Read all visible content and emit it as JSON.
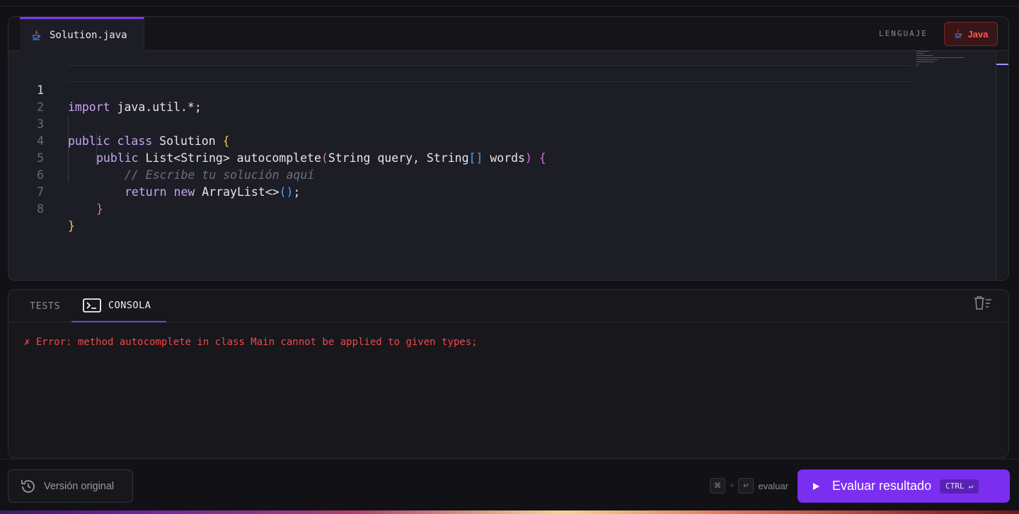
{
  "editor": {
    "file_tab": "Solution.java",
    "lang_label": "LENGUAJE",
    "lang_button": "Java",
    "line_numbers": [
      "1",
      "2",
      "3",
      "4",
      "5",
      "6",
      "7",
      "8"
    ],
    "accent_color": "#7c3aed",
    "lang_color": "#ff5a52"
  },
  "code": {
    "l1_kw": "import",
    "l1_rest": " java.util.*;",
    "l3_kw1": "public",
    "l3_kw2": "class",
    "l3_name": " Solution ",
    "l3_brace": "{",
    "l4_kw": "public",
    "l4_sig": " List<String> autocomplete",
    "l4_paren_open": "(",
    "l4_params1": "String query, String",
    "l4_brackets": "[]",
    "l4_params2": " words",
    "l4_paren_close": ")",
    "l4_brace": "{",
    "l5_comment": "// Escribe tu solución aquí",
    "l6_kw1": "return",
    "l6_kw2": "new",
    "l6_rest": " ArrayList<>",
    "l6_parens": "()",
    "l6_semi": ";",
    "l7_brace": "}",
    "l8_brace": "}"
  },
  "console": {
    "tab_tests": "TESTS",
    "tab_consola": "CONSOLA",
    "output": "✗ Error: method autocomplete in class Main cannot be applied to given types;",
    "error_color": "#f04848"
  },
  "footer": {
    "original_version": "Versión original",
    "key_cmd": "⌘",
    "key_plus": "+",
    "key_enter": "↵",
    "eval_hint": "evaluar",
    "eval_button": "Evaluar resultado",
    "ctrl_label": "CTRL",
    "ctrl_enter": "↵",
    "button_color": "#7a2ff0"
  },
  "icons": [
    "java-icon",
    "history-icon",
    "terminal-icon",
    "clear-console-icon",
    "play-icon"
  ]
}
